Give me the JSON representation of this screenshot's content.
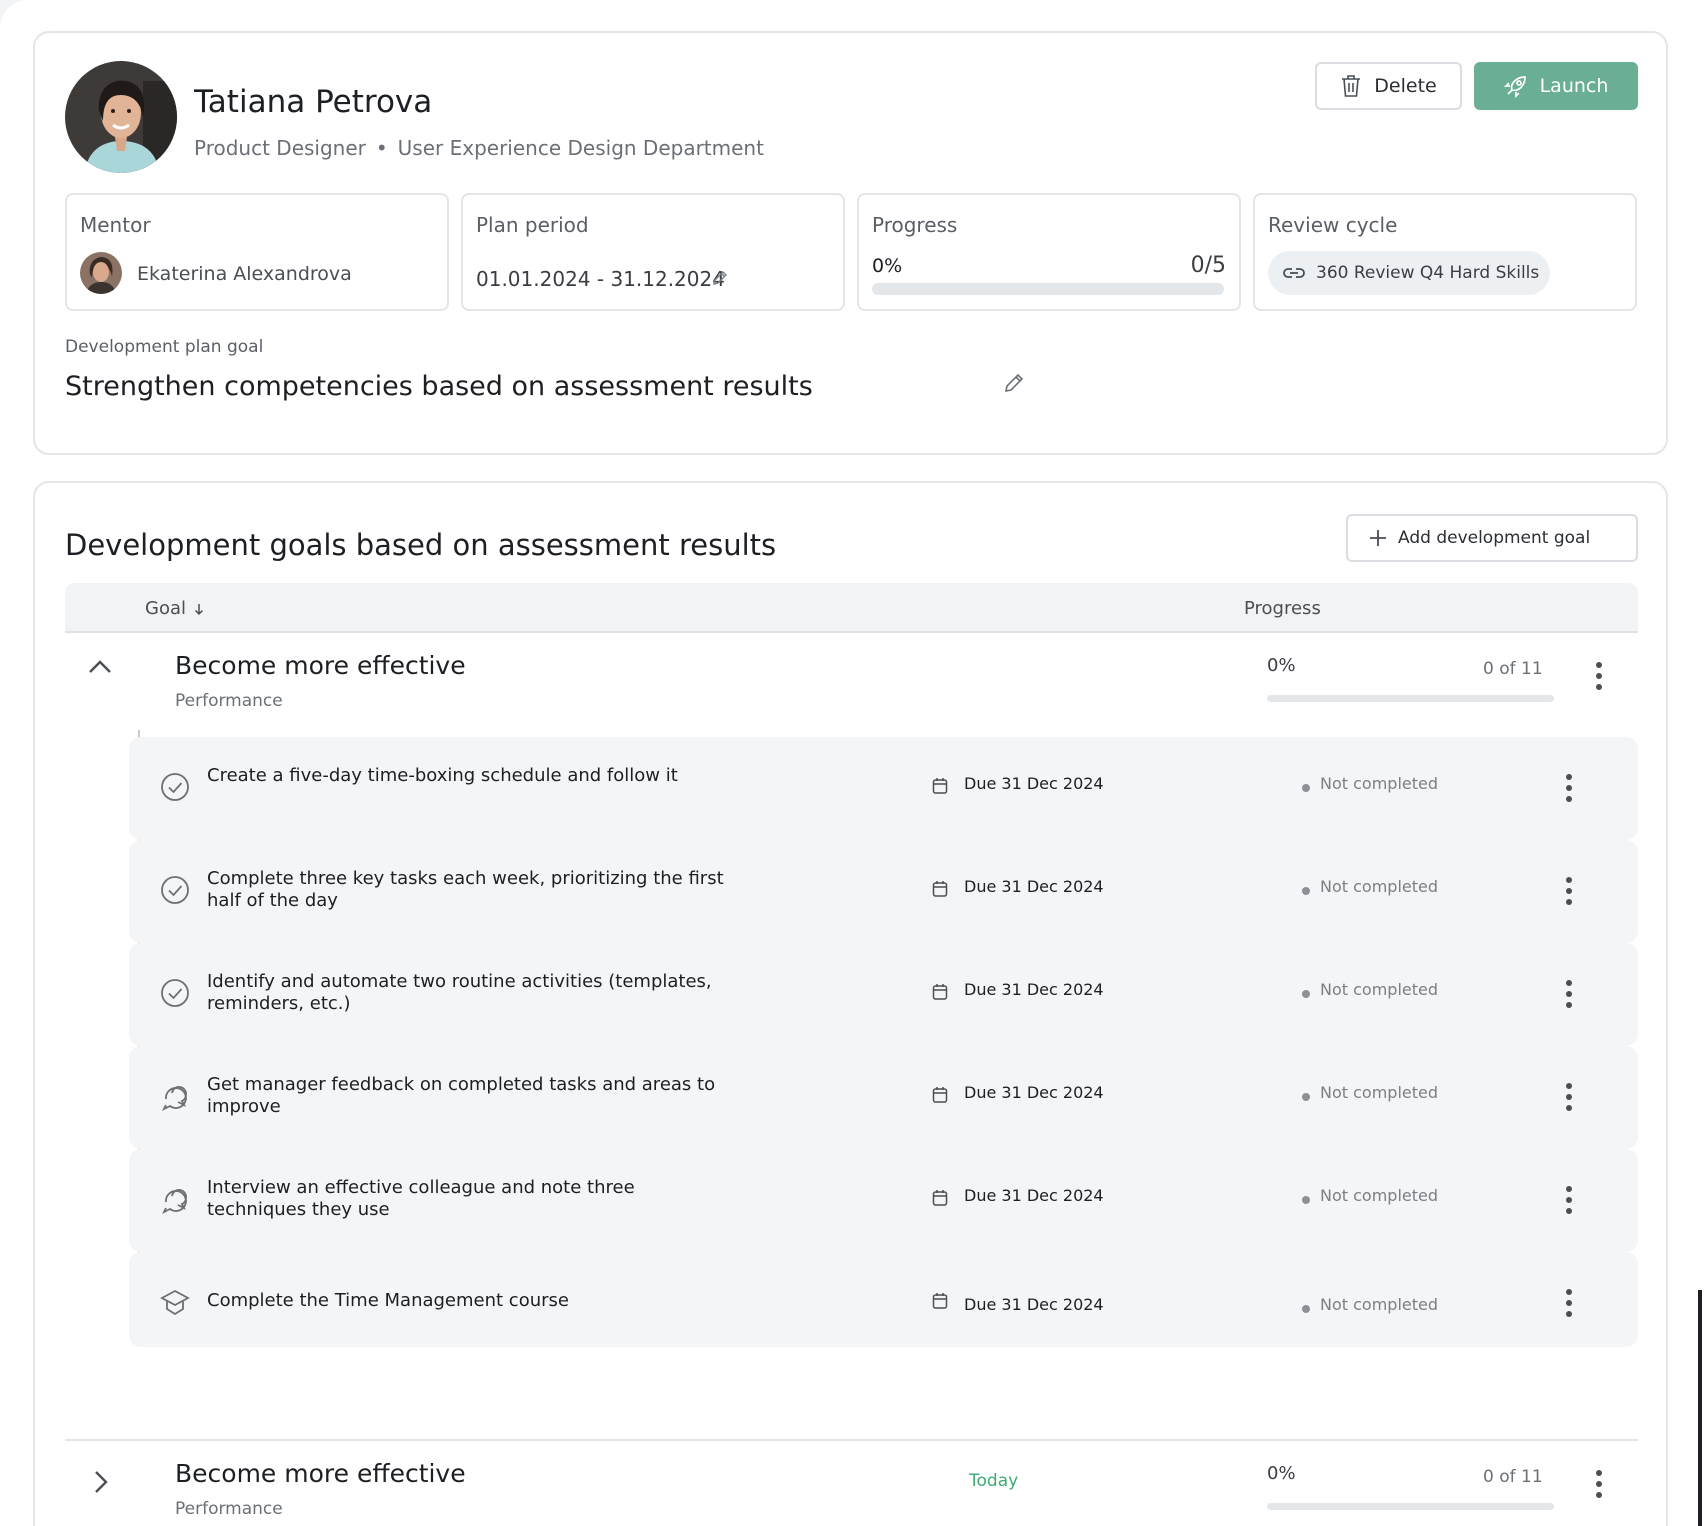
{
  "profile": {
    "name": "Tatiana Petrova",
    "role": "Product Designer",
    "separator": "•",
    "department": "User Experience Design Department",
    "delete_label": "Delete",
    "launch_label": "Launch",
    "mentor": {
      "label": "Mentor",
      "name": "Ekaterina Alexandrova"
    },
    "plan_period": {
      "label": "Plan period",
      "value": "01.01.2024 - 31.12.2024"
    },
    "progress": {
      "label": "Progress",
      "percent": "0%",
      "count": "0/5",
      "fraction": 0
    },
    "review_cycle": {
      "label": "Review cycle",
      "value": "360 Review Q4 Hard Skills"
    },
    "plan_goal": {
      "label": "Development plan goal",
      "value": "Strengthen competencies based on assessment results"
    }
  },
  "goals_section": {
    "title": "Development goals based on assessment results",
    "add_label": "Add development goal",
    "columns": {
      "goal": "Goal",
      "progress": "Progress"
    },
    "goals": [
      {
        "title": "Become more effective",
        "category": "Performance",
        "percent": "0%",
        "count": "0 of 11",
        "fraction": 0,
        "expanded": true,
        "tasks": [
          {
            "icon": "check-circle-icon",
            "text": "Create a five-day time-boxing schedule and follow it",
            "due": "Due 31 Dec 2024",
            "status": "Not completed"
          },
          {
            "icon": "check-circle-icon",
            "text": "Complete three key tasks each week, prioritizing the first half of the day",
            "due": "Due 31 Dec 2024",
            "status": "Not completed"
          },
          {
            "icon": "check-circle-icon",
            "text": "Identify and automate two routine activities (templates, reminders, etc.)",
            "due": "Due 31 Dec 2024",
            "status": "Not completed"
          },
          {
            "icon": "chat-bubbles-icon",
            "text": "Get manager feedback on completed tasks and areas to improve",
            "due": "Due 31 Dec 2024",
            "status": "Not completed"
          },
          {
            "icon": "chat-bubbles-icon",
            "text": "Interview an effective colleague and note three techniques they use",
            "due": "Due 31 Dec 2024",
            "status": "Not completed"
          },
          {
            "icon": "graduation-cap-icon",
            "text": "Complete the Time Management course",
            "due": "Due 31 Dec 2024",
            "status": "Not completed"
          }
        ]
      },
      {
        "title": "Become more effective",
        "category": "Performance",
        "due_tag": "Today",
        "percent": "0%",
        "count": "0 of 11",
        "fraction": 0,
        "expanded": false
      }
    ]
  },
  "colors": {
    "accent": "#6aae93",
    "today": "#3cab75",
    "task_bg": "#f4f5f6"
  }
}
